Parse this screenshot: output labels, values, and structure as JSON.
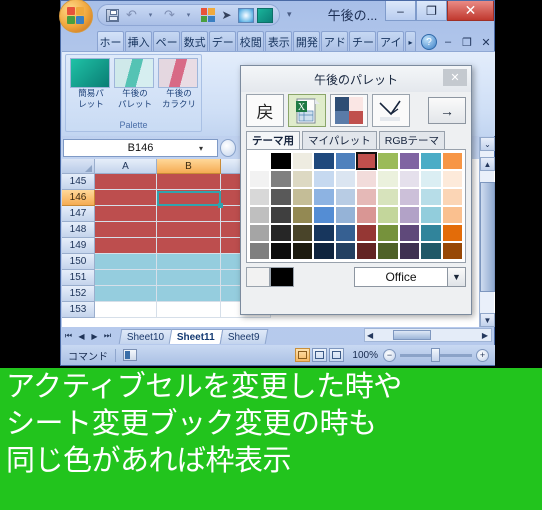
{
  "window": {
    "title": "午後の...",
    "minimize": "–",
    "maximize": "❐",
    "close": "✕"
  },
  "quick_access": {
    "save": "save-icon",
    "undo": "↶",
    "undo_dd": "▾",
    "redo": "↷",
    "redo_dd": "▾",
    "palette_grid": "grid-icon",
    "cursor": "➤",
    "swatch_blue": "blue-swatch",
    "swatch_teal": "teal-swatch",
    "overflow": "▾"
  },
  "ribbon_tabs": [
    {
      "label": "ホー"
    },
    {
      "label": "挿入"
    },
    {
      "label": "ペー"
    },
    {
      "label": "数式"
    },
    {
      "label": "デー"
    },
    {
      "label": "校閲"
    },
    {
      "label": "表示"
    },
    {
      "label": "開発"
    },
    {
      "label": "アド"
    },
    {
      "label": "チー"
    },
    {
      "label": "アイ"
    }
  ],
  "ribbon_right": {
    "overflow": "▸",
    "help": "?",
    "minimize_ribbon": "–",
    "restore": "❐",
    "close": "✕"
  },
  "palette_group": {
    "name": "Palette",
    "buttons": [
      {
        "label_1": "簡易パ",
        "label_2": "レット"
      },
      {
        "label_1": "午後の",
        "label_2": "パレット"
      },
      {
        "label_1": "午後の",
        "label_2": "カラクリ"
      }
    ]
  },
  "name_box": {
    "value": "B146",
    "dropdown": "▾"
  },
  "sheet": {
    "columns": [
      "A",
      "B"
    ],
    "active_column": "B",
    "rows": [
      "145",
      "146",
      "147",
      "148",
      "149",
      "150",
      "151",
      "152",
      "153"
    ],
    "active_row": "146",
    "fill_red": "#bd4e4e",
    "fill_blue": "#95cdde",
    "selection_color": "#31a3ad",
    "selected_cell": "B146"
  },
  "sheet_tabs": {
    "nav": [
      "⏮",
      "◀",
      "▶",
      "⏭"
    ],
    "tabs": [
      {
        "label": "Sheet10",
        "active": false
      },
      {
        "label": "Sheet11",
        "active": true
      },
      {
        "label": "Sheet9",
        "active": false
      }
    ]
  },
  "status_bar": {
    "mode": "コマンド",
    "record_macro": "record-macro-icon",
    "views": [
      "normal-view",
      "page-layout-view",
      "page-break-view"
    ],
    "active_view": "normal-view",
    "zoom": "100%",
    "zoom_out": "−",
    "zoom_in": "+"
  },
  "dialog": {
    "title": "午後のパレット",
    "close": "✕",
    "toolbar": {
      "back_label": "戻",
      "excel_icon": "excel-sheet-icon",
      "quad_icon": "color-quad-icon",
      "check_icon": "✓",
      "forward_label": "→"
    },
    "tabs": [
      {
        "label": "テーマ用",
        "active": true
      },
      {
        "label": "マイパレット",
        "active": false
      },
      {
        "label": "RGBテーマ",
        "active": false
      }
    ],
    "theme_select": {
      "value": "Office",
      "arrow": "▼"
    },
    "footer_swatches": [
      "#f2f2f2",
      "#000000"
    ],
    "selected_swatch_index": 5,
    "palette": [
      [
        "#ffffff",
        "#000000",
        "#eeece1",
        "#1f497d",
        "#4f81bd",
        "#c0504d",
        "#9bbb59",
        "#8064a2",
        "#4bacc6",
        "#f79646"
      ],
      [
        "#f2f2f2",
        "#808080",
        "#ddd9c3",
        "#c6d9f0",
        "#dbe5f1",
        "#f2dcdb",
        "#ebf1dd",
        "#e5e0ec",
        "#dbeef3",
        "#fdeada"
      ],
      [
        "#d8d8d8",
        "#595959",
        "#c4bd97",
        "#8db3e2",
        "#b8cce4",
        "#e5b9b7",
        "#d7e3bc",
        "#ccc0d9",
        "#b7dde8",
        "#fbd5b5"
      ],
      [
        "#bfbfbf",
        "#3f3f3f",
        "#938953",
        "#548dd4",
        "#95b3d7",
        "#d99694",
        "#c3d69b",
        "#b2a2c7",
        "#92cddc",
        "#fac08f"
      ],
      [
        "#a5a5a5",
        "#262626",
        "#494429",
        "#17365d",
        "#366092",
        "#953734",
        "#76923c",
        "#5f497a",
        "#31849b",
        "#e36c09"
      ],
      [
        "#7f7f7f",
        "#0c0c0c",
        "#1d1b10",
        "#0f243e",
        "#244061",
        "#632423",
        "#4f6128",
        "#3f3151",
        "#205867",
        "#974806"
      ]
    ]
  },
  "caption": {
    "line1": "アクティブセルを変更した時や",
    "line2": "シート変更ブック変更の時も",
    "line3": "同じ色があれば枠表示"
  }
}
